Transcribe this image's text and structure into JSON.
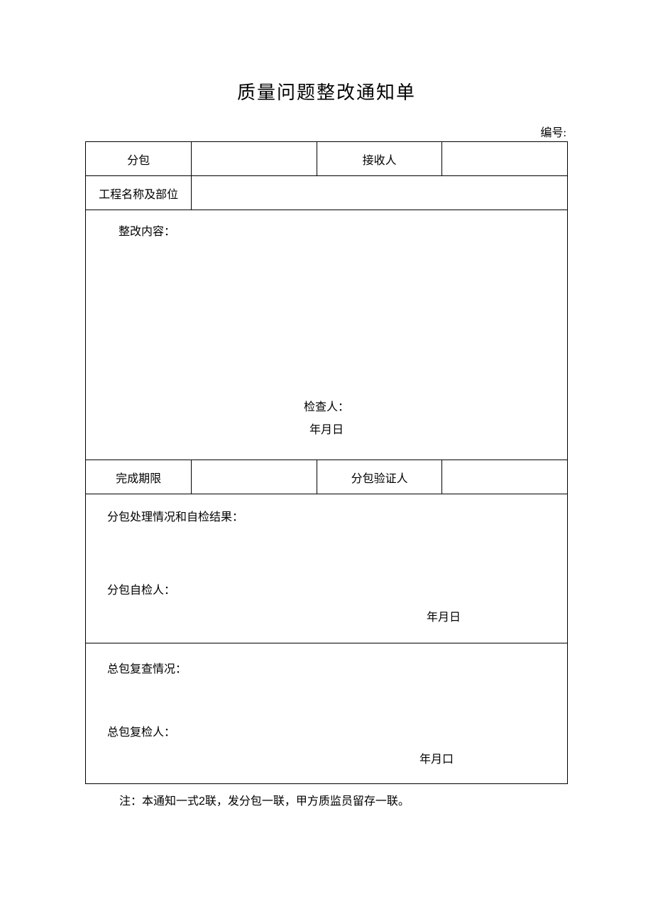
{
  "title": "质量问题整改通知单",
  "numberLabel": "编号:",
  "row1": {
    "c1": "分包",
    "c2": "",
    "c3": "接收人",
    "c4": ""
  },
  "row2": {
    "label": "工程名称及部位",
    "value": ""
  },
  "rectBlock": {
    "label": "整改内容：",
    "inspector": "检查人：",
    "date": "年月日"
  },
  "row3": {
    "c1": "完成期限",
    "c2": "",
    "c3": "分包验证人",
    "c4": ""
  },
  "midBlock": {
    "label": "分包处理情况和自检结果：",
    "signer": "分包自检人：",
    "date": "年月日"
  },
  "bottomBlock": {
    "label": "总包复查情况：",
    "signer": "总包复检人：",
    "date": "年月口"
  },
  "footnote": {
    "prefix": "注：本通知一式",
    "count": "2",
    "suffix": "联，发分包一联，甲方质监员留存一联。"
  }
}
